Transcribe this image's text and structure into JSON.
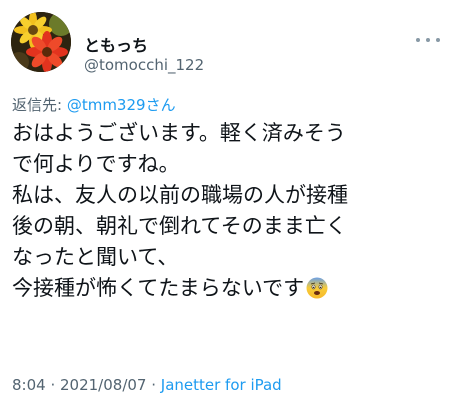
{
  "author": {
    "display_name": "ともっち",
    "handle": "@tomocchi_122",
    "avatar_icon": "flower-avatar-icon"
  },
  "more_icon": "more-dots-icon",
  "reply": {
    "label": "返信先: ",
    "target": "@tmm329さん"
  },
  "tweet": {
    "lines": [
      "おはようございます。軽く済みそう",
      "で何よりですね。",
      "私は、友人の以前の職場の人が接種",
      "後の朝、朝礼で倒れてそのまま亡く",
      "なったと聞いて、",
      "今接種が怖くてたまらないです"
    ],
    "emoji": "fearful-face-emoji-icon"
  },
  "meta": {
    "time": "8:04",
    "separator1": " · ",
    "date": "2021/08/07",
    "separator2": " · ",
    "client": "Janetter for iPad"
  },
  "colors": {
    "link": "#1d9bf0",
    "secondary_text": "#536471",
    "primary_text": "#0f1419"
  }
}
